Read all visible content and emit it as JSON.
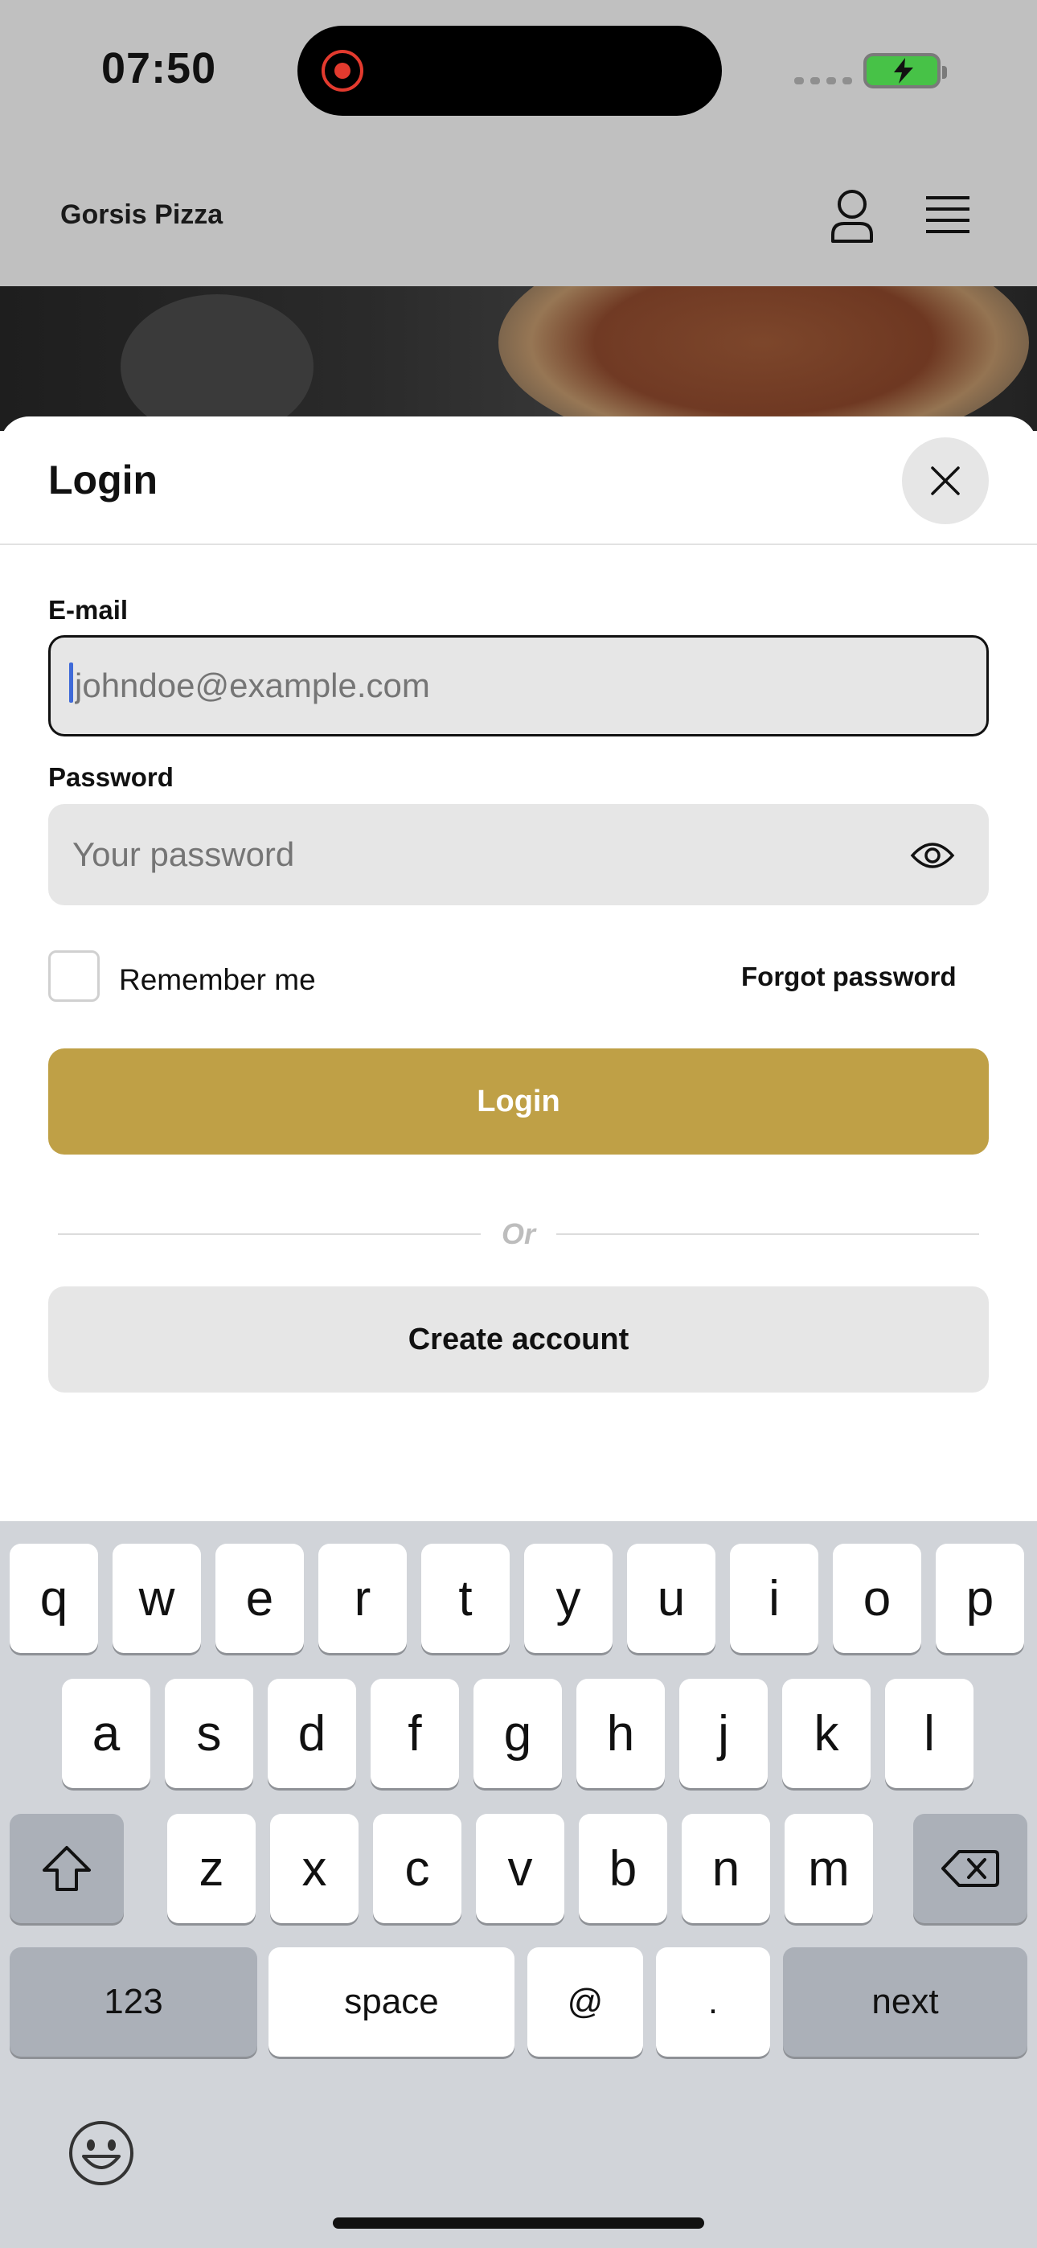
{
  "status_bar": {
    "time": "07:50"
  },
  "app_header": {
    "brand": "Gorsis Pizza"
  },
  "login_sheet": {
    "title": "Login",
    "email": {
      "label": "E-mail",
      "placeholder": "johndoe@example.com",
      "value": ""
    },
    "password": {
      "label": "Password",
      "placeholder": "Your password",
      "value": ""
    },
    "remember_label": "Remember me",
    "remember_checked": false,
    "forgot_label": "Forgot password",
    "login_label": "Login",
    "or_label": "Or",
    "create_label": "Create account"
  },
  "colors": {
    "accent": "#bfa046",
    "caret": "#3f6ad8",
    "keyboard_bg": "#d1d4d9"
  },
  "keyboard": {
    "row1": [
      "q",
      "w",
      "e",
      "r",
      "t",
      "y",
      "u",
      "i",
      "o",
      "p"
    ],
    "row2": [
      "a",
      "s",
      "d",
      "f",
      "g",
      "h",
      "j",
      "k",
      "l"
    ],
    "row3": [
      "z",
      "x",
      "c",
      "v",
      "b",
      "n",
      "m"
    ],
    "numbers_label": "123",
    "space_label": "space",
    "at_label": "@",
    "dot_label": ".",
    "next_label": "next"
  }
}
